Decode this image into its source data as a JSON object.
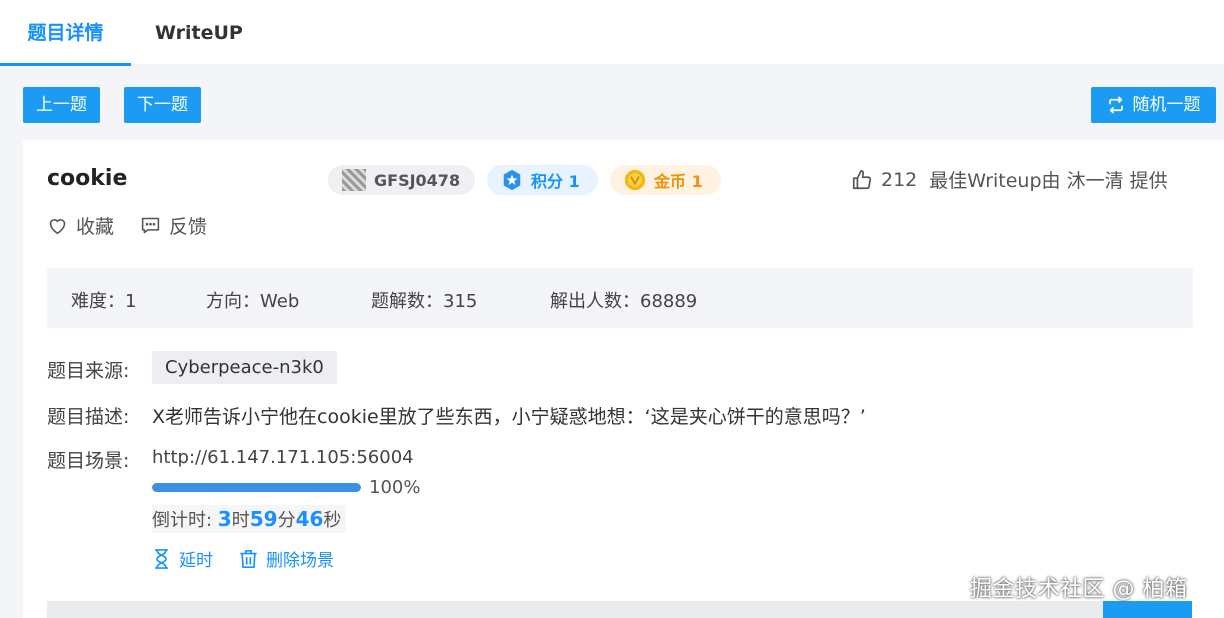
{
  "tabs": [
    {
      "label": "题目详情",
      "active": true
    },
    {
      "label": "WriteUP",
      "active": false
    }
  ],
  "nav": {
    "prev_label": "上一题",
    "next_label": "下一题",
    "random_label": "随机一题",
    "random_icon": "shuffle-icon"
  },
  "challenge": {
    "title": "cookie",
    "id_badge": "GFSJ0478",
    "score_badge": "积分 1",
    "coin_badge": "金币 1",
    "likes": "212",
    "best_writeup": "最佳Writeup由 沐一清 提供",
    "favorite_label": "收藏",
    "feedback_label": "反馈"
  },
  "stats": {
    "difficulty": "难度：1",
    "direction": "方向：Web",
    "solves": "题解数：315",
    "solvers": "解出人数：68889"
  },
  "details": {
    "source_label": "题目来源:",
    "source_value": "Cyberpeace-n3k0",
    "desc_label": "题目描述:",
    "desc_value": "X老师告诉小宁他在cookie里放了些东西，小宁疑惑地想：‘这是夹心饼干的意思吗？’",
    "scene_label": "题目场景:",
    "scene_url": "http://61.147.171.105:56004",
    "progress": 1.0,
    "progress_text": "100%",
    "countdown_prefix": "倒计时: ",
    "hours": "3",
    "hours_unit": "时",
    "minutes": "59",
    "minutes_unit": "分",
    "seconds": "46",
    "seconds_unit": "秒",
    "extend_label": "延时",
    "delete_label": "删除场景"
  },
  "colors": {
    "accent": "#1890ff",
    "button": "#1b9cf2",
    "coin": "#f2910a"
  },
  "watermark": "掘金技术社区 @ 柏箱"
}
